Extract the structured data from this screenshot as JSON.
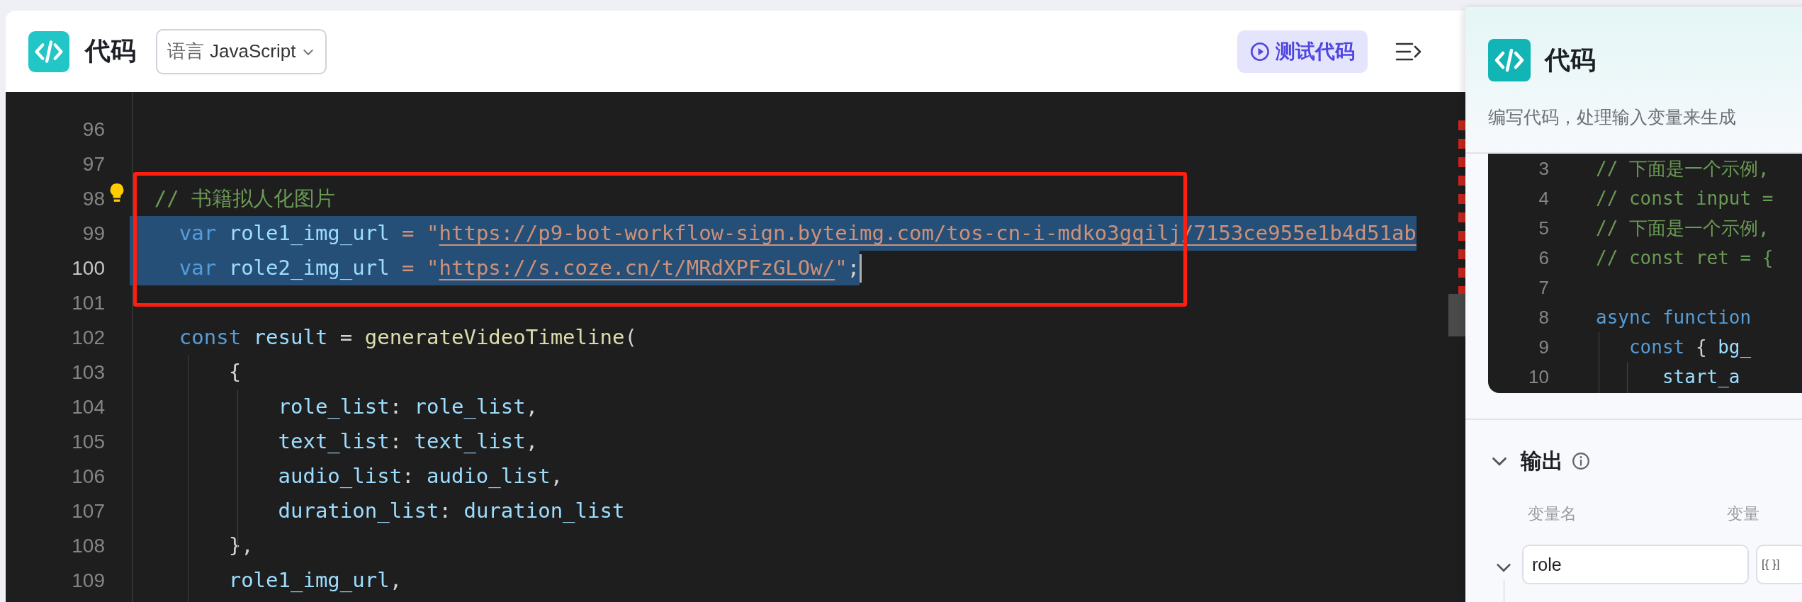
{
  "header": {
    "title": "代码",
    "language_label": "语言",
    "language": "JavaScript",
    "test_button": "测试代码"
  },
  "editor": {
    "lines": [
      {
        "number": "96",
        "selected": false,
        "current": false
      },
      {
        "number": "97",
        "selected": false,
        "current": false
      },
      {
        "number": "98",
        "selected": false,
        "current": false,
        "lightbulb": true,
        "tokens": [
          {
            "t": "    // 书籍拟人化图片",
            "kind": "comment"
          }
        ]
      },
      {
        "number": "99",
        "selected": true,
        "current": false,
        "tokens": [
          {
            "t": "    var",
            "kind": "kw"
          },
          {
            "t": " role1_img_url",
            "kind": "var"
          },
          {
            "t": " = \"",
            "kind": "str"
          },
          {
            "t": "https://p9-bot-workflow-sign.byteimg.com/tos-cn-i-mdko3gqilj/7153ce955e1b4d51ab",
            "kind": "link"
          }
        ]
      },
      {
        "number": "100",
        "selected": true,
        "current": true,
        "tokens": [
          {
            "t": "    var",
            "kind": "kw"
          },
          {
            "t": " role2_img_url",
            "kind": "var"
          },
          {
            "t": " = \"",
            "kind": "str"
          },
          {
            "t": "https://s.coze.cn/t/MRdXPFzGLOw/",
            "kind": "link"
          },
          {
            "t": "\"",
            "kind": "str"
          },
          {
            "t": ";",
            "kind": "plain"
          }
        ]
      },
      {
        "number": "101",
        "selected": false,
        "current": false
      },
      {
        "number": "102",
        "selected": false,
        "current": false,
        "tokens": [
          {
            "t": "    const",
            "kind": "kw"
          },
          {
            "t": " result",
            "kind": "var"
          },
          {
            "t": " = ",
            "kind": "plain"
          },
          {
            "t": "generateVideoTimeline",
            "kind": "fn"
          },
          {
            "t": "(",
            "kind": "plain"
          }
        ]
      },
      {
        "number": "103",
        "selected": false,
        "current": false,
        "tokens": [
          {
            "t": "        {",
            "kind": "plain"
          }
        ]
      },
      {
        "number": "104",
        "selected": false,
        "current": false,
        "tokens": [
          {
            "t": "            role_list",
            "kind": "var"
          },
          {
            "t": ": ",
            "kind": "plain"
          },
          {
            "t": "role_list",
            "kind": "var"
          },
          {
            "t": ",",
            "kind": "plain"
          }
        ]
      },
      {
        "number": "105",
        "selected": false,
        "current": false,
        "tokens": [
          {
            "t": "            text_list",
            "kind": "var"
          },
          {
            "t": ": ",
            "kind": "plain"
          },
          {
            "t": "text_list",
            "kind": "var"
          },
          {
            "t": ",",
            "kind": "plain"
          }
        ]
      },
      {
        "number": "106",
        "selected": false,
        "current": false,
        "tokens": [
          {
            "t": "            audio_list",
            "kind": "var"
          },
          {
            "t": ": ",
            "kind": "plain"
          },
          {
            "t": "audio_list",
            "kind": "var"
          },
          {
            "t": ",",
            "kind": "plain"
          }
        ]
      },
      {
        "number": "107",
        "selected": false,
        "current": false,
        "tokens": [
          {
            "t": "            duration_list",
            "kind": "var"
          },
          {
            "t": ": ",
            "kind": "plain"
          },
          {
            "t": "duration_list",
            "kind": "var"
          }
        ]
      },
      {
        "number": "108",
        "selected": false,
        "current": false,
        "tokens": [
          {
            "t": "        },",
            "kind": "plain"
          }
        ]
      },
      {
        "number": "109",
        "selected": false,
        "current": false,
        "tokens": [
          {
            "t": "        role1_img_url",
            "kind": "var"
          },
          {
            "t": ",",
            "kind": "plain"
          }
        ]
      }
    ]
  },
  "side_panel": {
    "title": "代码",
    "description": "编写代码，处理输入变量来生成",
    "code_lines": [
      {
        "number": "3",
        "tokens": [
          {
            "t": "// 下面是一个示例,",
            "kind": "comment"
          }
        ]
      },
      {
        "number": "4",
        "tokens": [
          {
            "t": "// const input =",
            "kind": "comment"
          }
        ]
      },
      {
        "number": "5",
        "tokens": [
          {
            "t": "// 下面是一个示例,",
            "kind": "comment"
          }
        ]
      },
      {
        "number": "6",
        "tokens": [
          {
            "t": "// const ret = {",
            "kind": "comment"
          }
        ]
      },
      {
        "number": "7"
      },
      {
        "number": "8",
        "tokens": [
          {
            "t": "async function",
            "kind": "kw"
          }
        ]
      },
      {
        "number": "9",
        "tokens": [
          {
            "t": "   const",
            "kind": "kw"
          },
          {
            "t": " { ",
            "kind": "plain"
          },
          {
            "t": "bg_",
            "kind": "var"
          }
        ]
      },
      {
        "number": "10",
        "tokens": [
          {
            "t": "      start_a",
            "kind": "var"
          }
        ]
      }
    ],
    "output": {
      "title": "输出",
      "expanded": true,
      "columns": [
        "变量名",
        "变量"
      ],
      "rows": [
        {
          "name": "role",
          "type": "[{ }]",
          "expanded": true
        }
      ]
    }
  }
}
